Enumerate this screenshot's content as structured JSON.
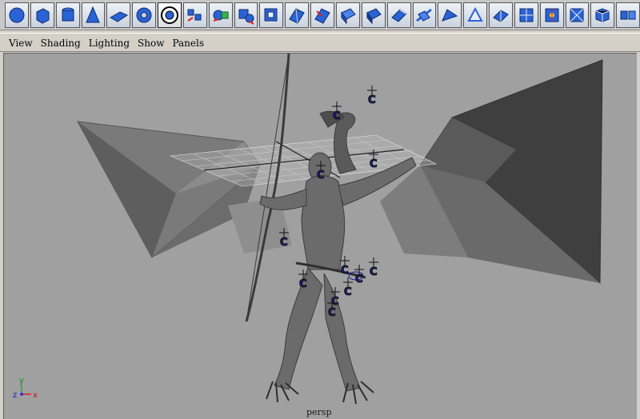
{
  "shelf": {
    "tools": [
      {
        "name": "poly-sphere-icon"
      },
      {
        "name": "poly-cube-icon"
      },
      {
        "name": "poly-cylinder-icon"
      },
      {
        "name": "poly-cone-icon"
      },
      {
        "name": "poly-plane-icon"
      },
      {
        "name": "poly-torus-icon"
      },
      {
        "name": "poly-pipe-icon"
      },
      {
        "name": "combine-icon"
      },
      {
        "name": "separate-icon"
      },
      {
        "name": "split-polygon-icon"
      },
      {
        "name": "soft-selection-icon"
      },
      {
        "name": "mesh-select-icon"
      },
      {
        "name": "extrude-face-icon"
      },
      {
        "name": "extrude-edge-icon"
      },
      {
        "name": "bevel-icon"
      },
      {
        "name": "wedge-face-icon"
      },
      {
        "name": "duplicate-face-icon"
      },
      {
        "name": "merge-vertices-icon"
      },
      {
        "name": "append-polygon-icon"
      },
      {
        "name": "cut-faces-icon"
      },
      {
        "name": "subdivide-icon"
      },
      {
        "name": "smooth-icon"
      },
      {
        "name": "triangulate-icon"
      },
      {
        "name": "quadrangulate-icon"
      },
      {
        "name": "mirror-icon"
      }
    ],
    "accent_color": "#1f54c9"
  },
  "menubar": {
    "view": "View",
    "shading": "Shading",
    "lighting": "Lighting",
    "show": "Show",
    "panels": "Panels"
  },
  "viewport": {
    "camera": "persp",
    "background_color": "#a0a0a0",
    "handle_glyph": "C",
    "axis": {
      "x": "x",
      "y": "y",
      "z": "z"
    }
  }
}
